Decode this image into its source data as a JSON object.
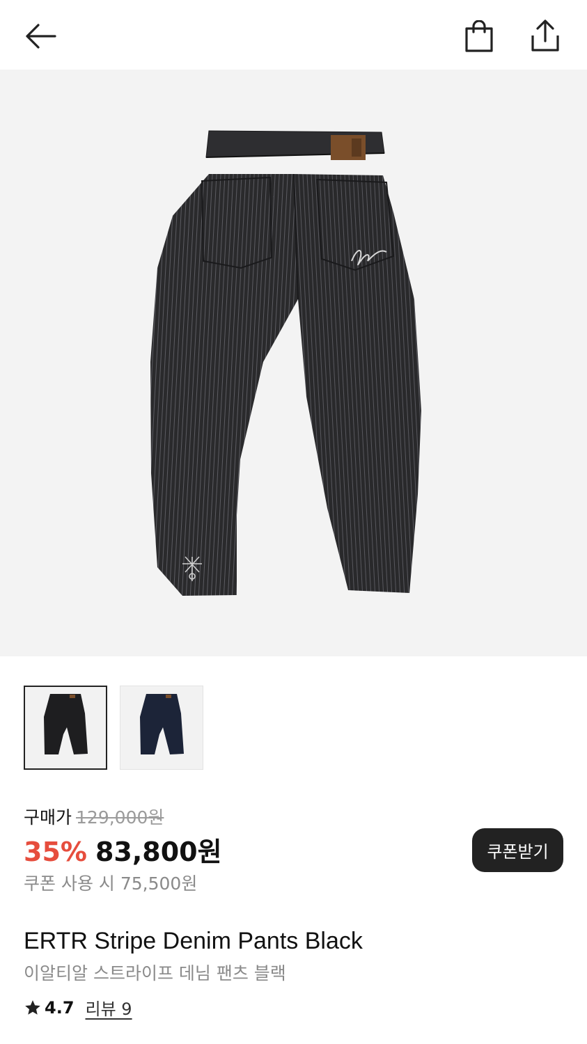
{
  "header": {
    "back_icon": "arrow-left-icon",
    "bag_icon": "shopping-bag-icon",
    "share_icon": "share-upload-icon"
  },
  "gallery": {
    "image_count": 2,
    "current_index": 1,
    "progress_fraction": 0.5
  },
  "thumbnails": [
    {
      "color": "black",
      "selected": true
    },
    {
      "color": "navy",
      "selected": false
    }
  ],
  "pricing": {
    "label": "구매가",
    "original_price": "129,000원",
    "discount": "35%",
    "sale_price": "83,800원",
    "coupon_price_text": "쿠폰 사용 시 75,500원",
    "coupon_button": "쿠폰받기",
    "discount_color": "#e64d3d"
  },
  "product": {
    "name_en": "ERTR Stripe Denim Pants Black",
    "name_ko": "이알티알 스트라이프 데님 팬츠 블랙",
    "rating": "4.7",
    "review_link": "리뷰 9"
  }
}
